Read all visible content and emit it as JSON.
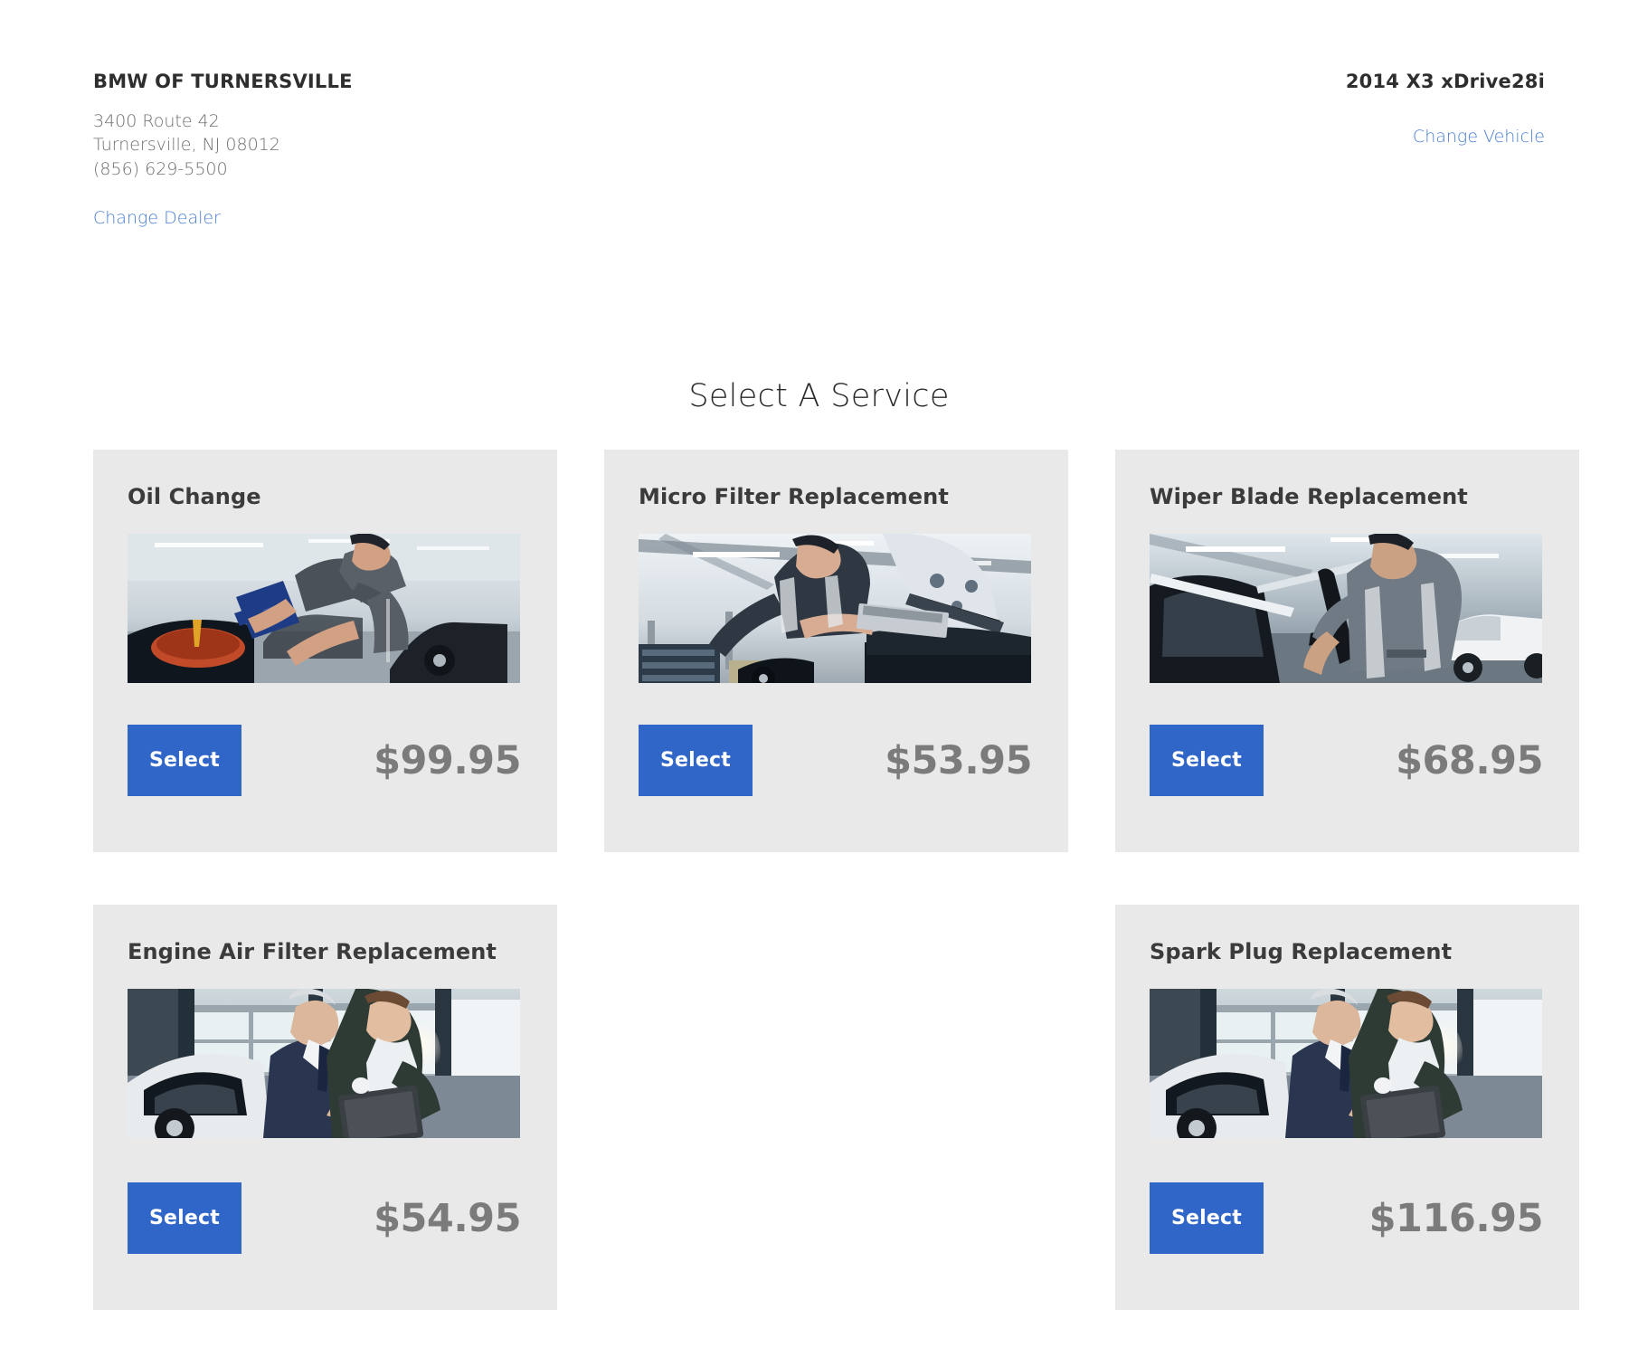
{
  "dealer": {
    "name": "BMW OF TURNERSVILLE",
    "address_line1": "3400 Route 42",
    "address_line2": "Turnersville, NJ 08012",
    "phone": "(856) 629-5500",
    "change_dealer_label": "Change Dealer"
  },
  "vehicle": {
    "name": "2014 X3 xDrive28i",
    "change_vehicle_label": "Change Vehicle"
  },
  "page": {
    "section_title": "Select A Service"
  },
  "colors": {
    "accent_blue": "#2f66c8",
    "link_blue": "#4a7fd4",
    "card_background": "#e9e9e9",
    "price_gray": "#7b7b7b",
    "title_dark": "#3b3b3b"
  },
  "services": [
    {
      "title": "Oil Change",
      "price": "$99.95",
      "select_label": "Select",
      "image_name": "technician-pouring-oil-photo"
    },
    {
      "title": "Micro Filter Replacement",
      "price": "$53.95",
      "select_label": "Select",
      "image_name": "technician-installing-cabin-filter-photo"
    },
    {
      "title": "Wiper Blade Replacement",
      "price": "$68.95",
      "select_label": "Select",
      "image_name": "technician-replacing-wiper-blade-photo"
    },
    {
      "title": "Engine Air Filter Replacement",
      "price": "$54.95",
      "select_label": "Select",
      "image_name": "advisor-and-customer-with-tablet-photo"
    },
    {
      "title": "Spark Plug Replacement",
      "price": "$116.95",
      "select_label": "Select",
      "image_name": "advisor-and-customer-with-tablet-photo"
    }
  ]
}
